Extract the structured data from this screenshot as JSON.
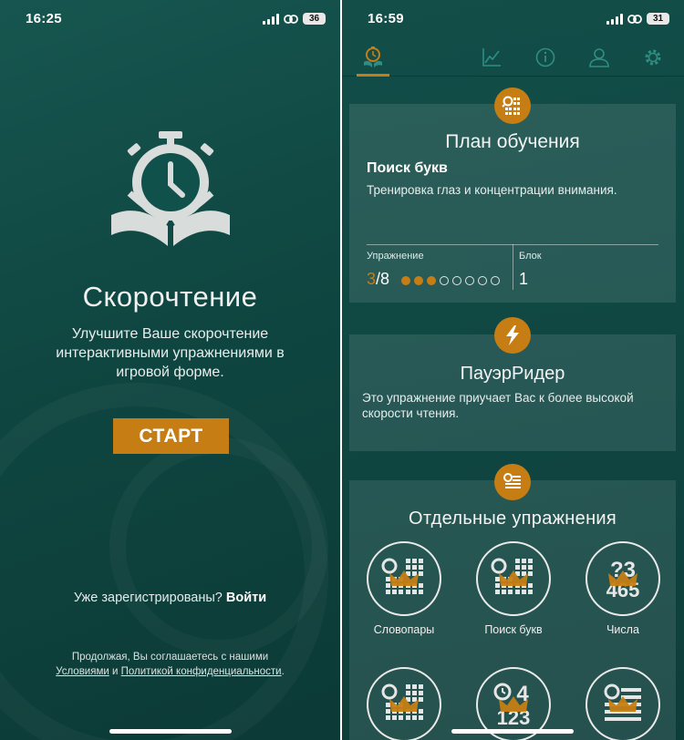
{
  "colors": {
    "accent": "#c67e14",
    "background": "#0f4641",
    "card": "rgba(255,255,255,0.10)",
    "text": "#ffffff"
  },
  "left_screen": {
    "status": {
      "time": "16:25",
      "battery": "36"
    },
    "logo_icon": "stopwatch-book-icon",
    "title": "Скорочтение",
    "subtitle": "Улучшите Ваше скорочтение интерактивными упражнениями в игровой форме.",
    "start_button": "СТАРТ",
    "login_prompt": "Уже зарегистрированы?",
    "login_link": "Войти",
    "terms": {
      "prefix": "Продолжая, Вы соглашаетесь с нашими",
      "terms_link": "Условиями",
      "and": "и",
      "privacy_link": "Политикой конфиденциальности",
      "suffix": "."
    }
  },
  "right_screen": {
    "status": {
      "time": "16:59",
      "battery": "31"
    },
    "nav": [
      {
        "icon": "stopwatch-book-icon",
        "active": true
      },
      {
        "icon": "chart-icon",
        "active": false
      },
      {
        "icon": "info-icon",
        "active": false
      },
      {
        "icon": "user-icon",
        "active": false
      },
      {
        "icon": "gear-icon",
        "active": false
      }
    ],
    "plan_card": {
      "icon": "grid-search-icon",
      "title": "План обучения",
      "exercise_name": "Поиск букв",
      "exercise_desc": "Тренировка глаз и концентрации внимания.",
      "exercise_label": "Упражнение",
      "progress_current": "3",
      "progress_total": "/8",
      "progress_done": 3,
      "progress_count": 8,
      "block_label": "Блок",
      "block_value": "1"
    },
    "power_card": {
      "icon": "lightning-icon",
      "title": "ПауэрРидер",
      "desc": "Это упражнение приучает Вас к более высокой скорости чтения."
    },
    "separate_card": {
      "icon": "list-icon",
      "title": "Отдельные упражнения",
      "exercises": [
        {
          "label": "Словопары",
          "icon": "grid-search-crown-icon"
        },
        {
          "label": "Поиск букв",
          "icon": "grid-search-crown-icon"
        },
        {
          "label": "Числа",
          "icon": "numbers-crown-icon",
          "glyph_top": "?3",
          "glyph_bottom": "465"
        },
        {
          "label": "",
          "icon": "grid-search-crown-icon"
        },
        {
          "label": "",
          "icon": "stopwatch-numbers-crown-icon",
          "glyph_top": "4",
          "glyph_bottom": "123"
        },
        {
          "label": "",
          "icon": "search-list-crown-icon"
        }
      ]
    }
  }
}
